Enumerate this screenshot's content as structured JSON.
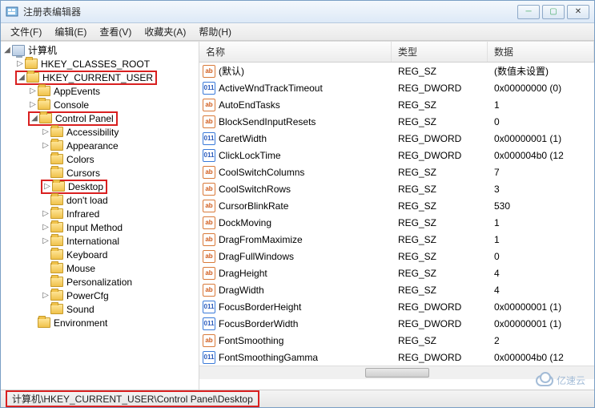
{
  "window": {
    "title": "注册表编辑器"
  },
  "menu": {
    "file": "文件(F)",
    "edit": "编辑(E)",
    "view": "查看(V)",
    "fav": "收藏夹(A)",
    "help": "帮助(H)"
  },
  "tree": {
    "root": "计算机",
    "hkcr": "HKEY_CLASSES_ROOT",
    "hkcu": "HKEY_CURRENT_USER",
    "appEvents": "AppEvents",
    "console": "Console",
    "controlPanel": "Control Panel",
    "accessibility": "Accessibility",
    "appearance": "Appearance",
    "colors": "Colors",
    "cursors": "Cursors",
    "desktop": "Desktop",
    "dontload": "don't load",
    "infrared": "Infrared",
    "inputMethod": "Input Method",
    "international": "International",
    "keyboard": "Keyboard",
    "mouse": "Mouse",
    "personalization": "Personalization",
    "powercfg": "PowerCfg",
    "sound": "Sound",
    "environment": "Environment"
  },
  "columns": {
    "name": "名称",
    "type": "类型",
    "data": "数据"
  },
  "values": [
    {
      "icon": "sz",
      "name": "(默认)",
      "type": "REG_SZ",
      "data": "(数值未设置)"
    },
    {
      "icon": "dw",
      "name": "ActiveWndTrackTimeout",
      "type": "REG_DWORD",
      "data": "0x00000000 (0)"
    },
    {
      "icon": "sz",
      "name": "AutoEndTasks",
      "type": "REG_SZ",
      "data": "1"
    },
    {
      "icon": "sz",
      "name": "BlockSendInputResets",
      "type": "REG_SZ",
      "data": "0"
    },
    {
      "icon": "dw",
      "name": "CaretWidth",
      "type": "REG_DWORD",
      "data": "0x00000001 (1)"
    },
    {
      "icon": "dw",
      "name": "ClickLockTime",
      "type": "REG_DWORD",
      "data": "0x000004b0 (12"
    },
    {
      "icon": "sz",
      "name": "CoolSwitchColumns",
      "type": "REG_SZ",
      "data": "7"
    },
    {
      "icon": "sz",
      "name": "CoolSwitchRows",
      "type": "REG_SZ",
      "data": "3"
    },
    {
      "icon": "sz",
      "name": "CursorBlinkRate",
      "type": "REG_SZ",
      "data": "530"
    },
    {
      "icon": "sz",
      "name": "DockMoving",
      "type": "REG_SZ",
      "data": "1"
    },
    {
      "icon": "sz",
      "name": "DragFromMaximize",
      "type": "REG_SZ",
      "data": "1"
    },
    {
      "icon": "sz",
      "name": "DragFullWindows",
      "type": "REG_SZ",
      "data": "0"
    },
    {
      "icon": "sz",
      "name": "DragHeight",
      "type": "REG_SZ",
      "data": "4"
    },
    {
      "icon": "sz",
      "name": "DragWidth",
      "type": "REG_SZ",
      "data": "4"
    },
    {
      "icon": "dw",
      "name": "FocusBorderHeight",
      "type": "REG_DWORD",
      "data": "0x00000001 (1)"
    },
    {
      "icon": "dw",
      "name": "FocusBorderWidth",
      "type": "REG_DWORD",
      "data": "0x00000001 (1)"
    },
    {
      "icon": "sz",
      "name": "FontSmoothing",
      "type": "REG_SZ",
      "data": "2"
    },
    {
      "icon": "dw",
      "name": "FontSmoothingGamma",
      "type": "REG_DWORD",
      "data": "0x000004b0 (12"
    }
  ],
  "status": {
    "path": "计算机\\HKEY_CURRENT_USER\\Control Panel\\Desktop"
  },
  "watermark": "亿速云"
}
